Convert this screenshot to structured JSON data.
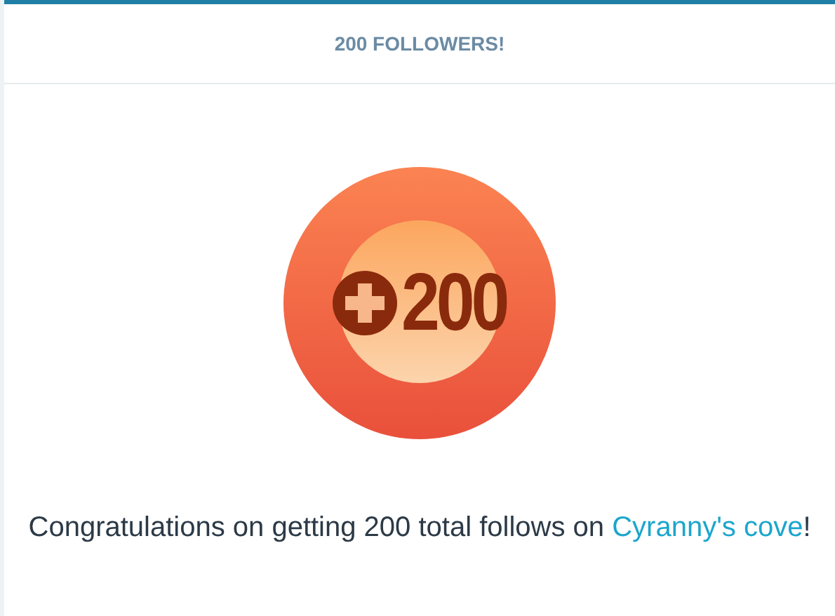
{
  "dialog": {
    "title": "200 FOLLOWERS!",
    "badge": {
      "text": "200"
    },
    "message": {
      "text_before": "Congratulations on getting 200 total follows on ",
      "link": "Cyranny's cove",
      "text_after": "!"
    }
  }
}
